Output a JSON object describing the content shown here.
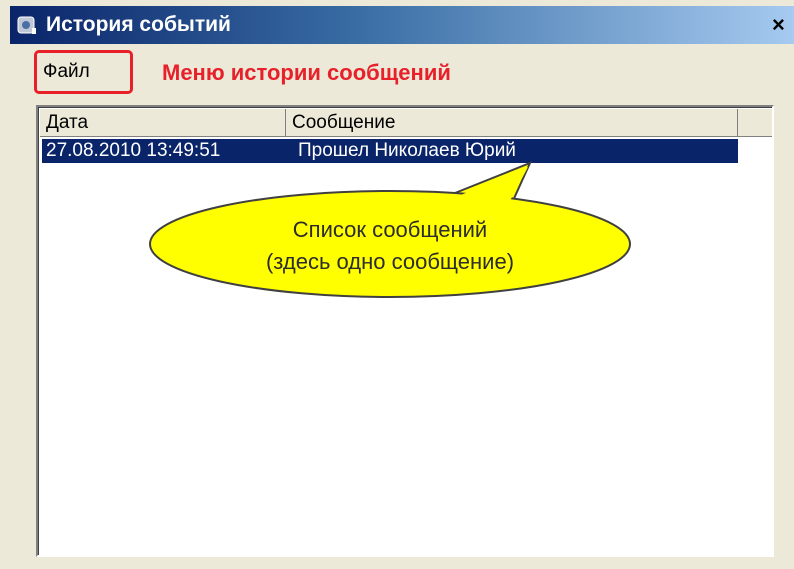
{
  "window": {
    "title": "История событий",
    "close_glyph": "×"
  },
  "menu": {
    "file_label": "Файл",
    "annotation": "Меню истории сообщений"
  },
  "list": {
    "columns": [
      "Дата",
      "Сообщение"
    ],
    "rows": [
      {
        "date": "27.08.2010 13:49:51",
        "message": "Прошел Николаев Юрий",
        "selected": true
      }
    ]
  },
  "callout": {
    "line1": "Список сообщений",
    "line2": "(здесь одно сообщение)"
  },
  "colors": {
    "accent": "#e8202a",
    "selection": "#0a246a",
    "callout_fill": "#ffff00"
  },
  "icons": {
    "app": "app-icon",
    "close": "close-icon"
  }
}
